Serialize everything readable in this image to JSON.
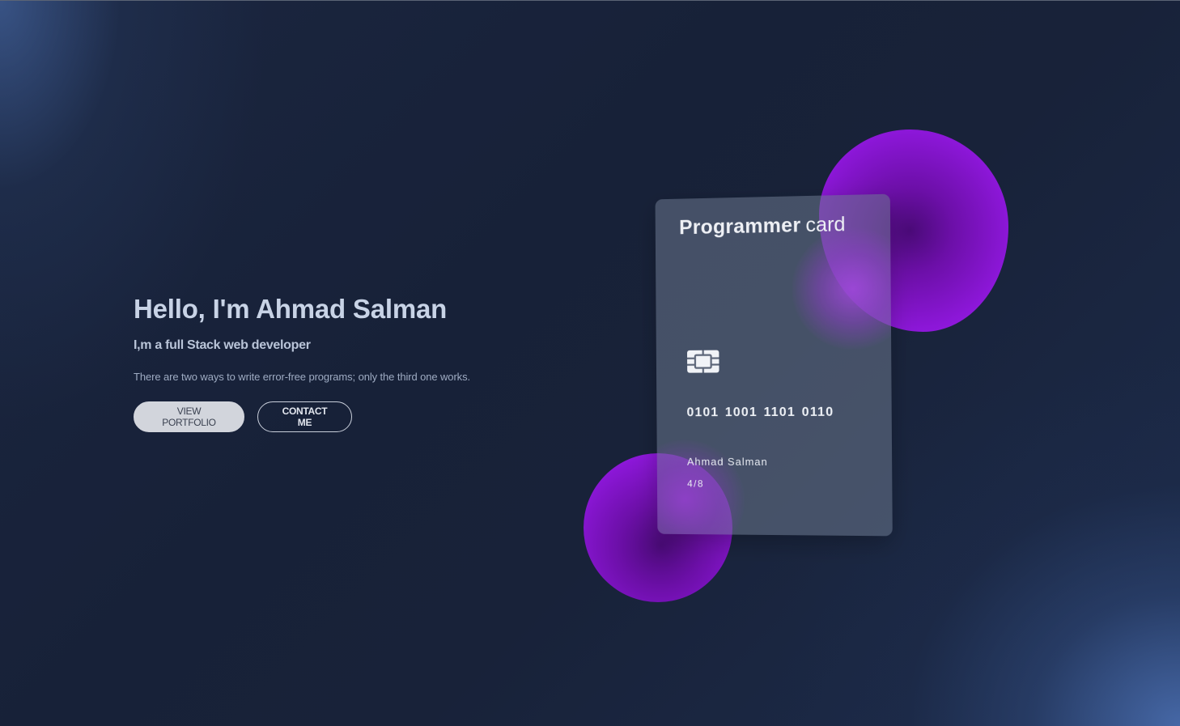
{
  "hero": {
    "title": "Hello, I'm Ahmad Salman",
    "subtitle": "I,m a full Stack web developer",
    "quote": "There are two ways to write error-free programs; only the third one works.",
    "buttons": {
      "portfolio_label": "VIEW PORTFOLIO",
      "contact_label": "CONTACT ME"
    }
  },
  "card": {
    "title_strong": "Programmer",
    "title_light": "card",
    "chip_icon": "chip-icon",
    "number": "0101 1001 1101 0110",
    "holder": "Ahmad Salman",
    "expiry": "4/8"
  },
  "colors": {
    "background": "#18223a",
    "blob_purple": "#8c17d8",
    "button_primary_bg": "#d2d5dc"
  }
}
